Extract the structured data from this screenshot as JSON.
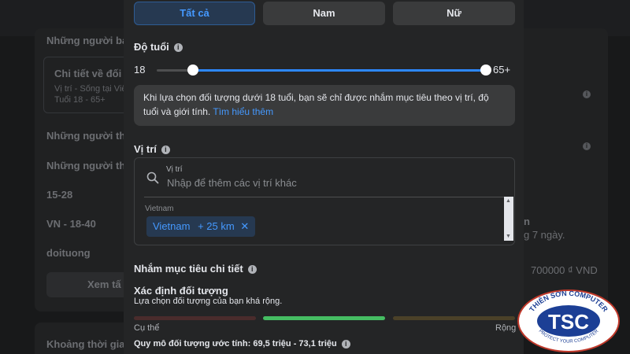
{
  "background": {
    "left_items": [
      "Những người bạ",
      "Chi tiết về đối t",
      "Vị trí - Sống tại Việ",
      "Tuổi 18 - 65+",
      "Những người thíc",
      "Những người thíc",
      "15-28",
      "VN - 18-40",
      "doituong",
      "Xem tấ",
      "Khoảng thời gia"
    ],
    "right_items": [
      "n",
      "g 7 ngày.",
      "700000 ₫ VND"
    ]
  },
  "gender": {
    "options": [
      "Tất cả",
      "Nam",
      "Nữ"
    ],
    "selected": "Tất cả"
  },
  "age": {
    "label": "Độ tuổi",
    "min_label": "18",
    "max_label": "65+",
    "min_fraction": 0.11,
    "max_fraction": 1.0,
    "notice": "Khi lựa chọn đối tượng dưới 18 tuổi, bạn sẽ chỉ được nhắm mục tiêu theo vị trí, độ tuổi và giới tính.",
    "notice_link": "Tìm hiểu thêm"
  },
  "location": {
    "label": "Vị trí",
    "field_label": "Vị trí",
    "placeholder": "Nhập để thêm các vị trí khác",
    "country": "Vietnam",
    "chip_name": "Vietnam",
    "chip_radius": "+ 25 km",
    "chip_close": "✕"
  },
  "detailed": {
    "label": "Nhắm mục tiêu chi tiết"
  },
  "definition": {
    "title": "Xác định đối tượng",
    "description": "Lựa chọn đối tượng của bạn khá rộng.",
    "left_label": "Cụ thể",
    "right_label": "Rộng",
    "meter_colors": [
      "#4a2c2c",
      "#45bd62",
      "#4b4128"
    ],
    "estimate": "Quy mô đối tượng ước tính: 69,5 triệu - 73,1 triệu"
  },
  "logo": {
    "top_text": "THIÊN SƠN COMPUTER",
    "abbr": "TSC",
    "bottom_text": "PROTECT YOUR COMPUTER"
  }
}
